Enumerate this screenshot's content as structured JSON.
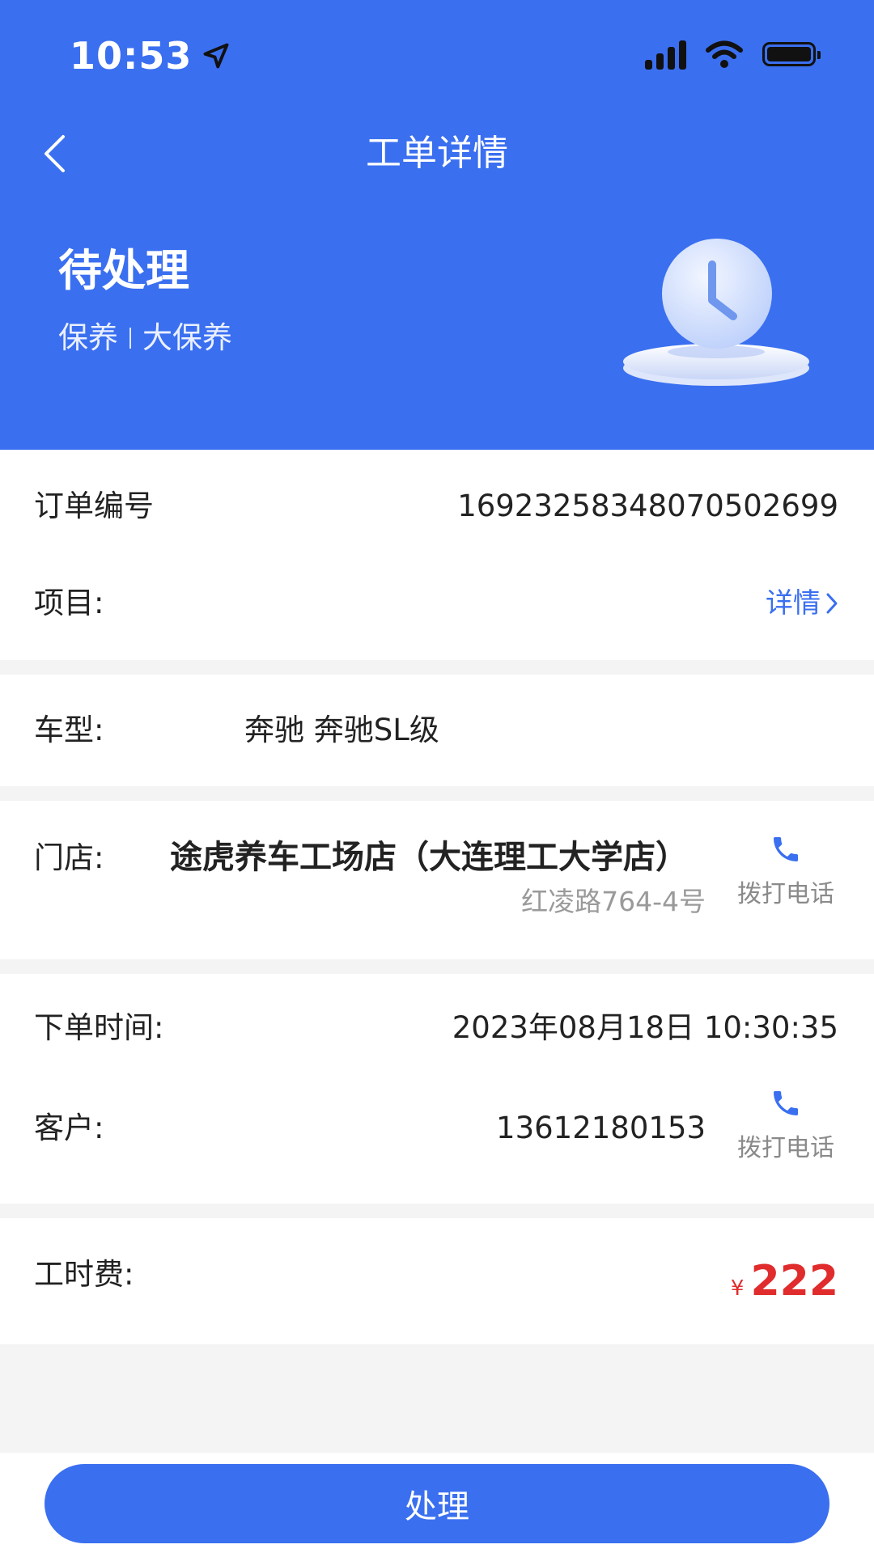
{
  "status_bar": {
    "time": "10:53"
  },
  "nav": {
    "title": "工单详情"
  },
  "order_status": {
    "title": "待处理",
    "category": "保养",
    "sub_category": "大保养"
  },
  "order": {
    "number_label": "订单编号",
    "number_value": "16923258348070502699",
    "project_label": "项目:",
    "project_link": "详情"
  },
  "vehicle": {
    "label": "车型:",
    "value": "奔驰 奔驰SL级"
  },
  "store": {
    "label": "门店:",
    "name": "途虎养车工场店（大连理工大学店）",
    "address": "红凌路764-4号",
    "call_label": "拨打电话"
  },
  "customer": {
    "time_label": "下单时间:",
    "time_value": "2023年08月18日 10:30:35",
    "label": "客户:",
    "phone": "13612180153",
    "call_label": "拨打电话"
  },
  "fee": {
    "label": "工时费:",
    "currency": "¥",
    "amount": "222"
  },
  "action": {
    "label": "处理"
  },
  "colors": {
    "primary": "#3a6ff0",
    "price": "#e02c2c",
    "background": "#f4f4f4"
  }
}
